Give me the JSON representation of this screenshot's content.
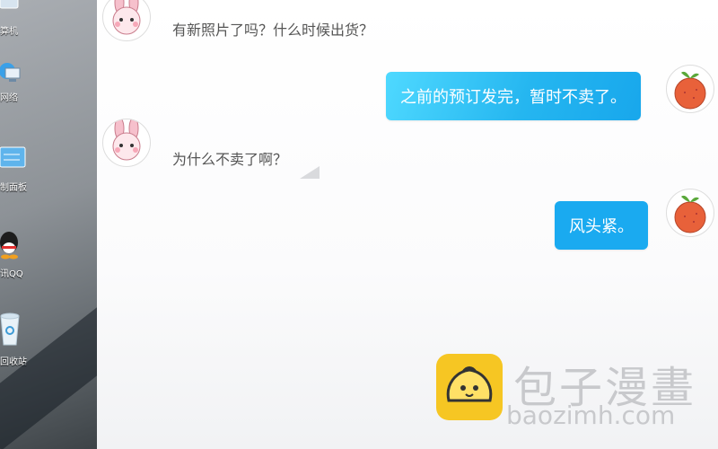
{
  "desktop": {
    "items": [
      {
        "label": "算机",
        "icon": "computer-icon"
      },
      {
        "label": "网络",
        "icon": "network-icon"
      },
      {
        "label": "制面板",
        "icon": "control-panel-icon"
      },
      {
        "label": "讯QQ",
        "icon": "qq-icon"
      },
      {
        "label": "回收站",
        "icon": "recycle-bin-icon"
      }
    ]
  },
  "chat": {
    "messages": [
      {
        "side": "in",
        "text": "有新照片了吗？什么时候出货？"
      },
      {
        "side": "out",
        "text": "之前的预订发完，暂时不卖了。"
      },
      {
        "side": "in",
        "text": "为什么不卖了啊？"
      },
      {
        "side": "out",
        "text": "风头紧。"
      }
    ]
  },
  "watermark": {
    "text": "包子漫畫",
    "url": "baozimh.com"
  },
  "colors": {
    "bubble_out": "#1aaaf0",
    "bubble_out_light": "#4fd9ff",
    "logo": "#f6c623"
  }
}
